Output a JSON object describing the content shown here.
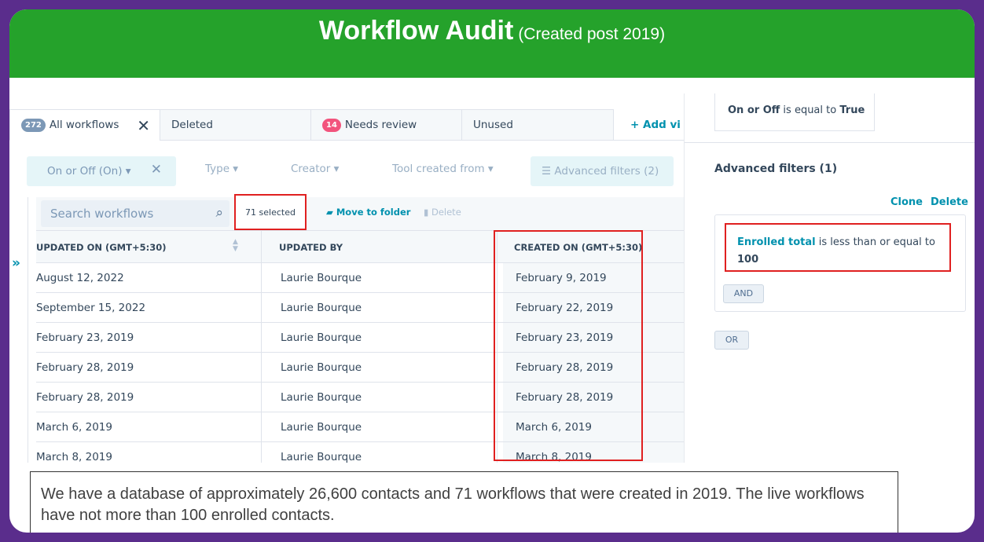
{
  "banner": {
    "title": "Workflow Audit",
    "subtitle": "(Created post 2019)"
  },
  "tabs": [
    {
      "badge": "272",
      "badge_color": "#7c98b6",
      "label": "All workflows"
    },
    {
      "label": "Deleted"
    },
    {
      "badge": "14",
      "badge_color": "#f2547d",
      "label": "Needs review"
    },
    {
      "label": "Unused"
    }
  ],
  "add_view_label": "+ Add vi",
  "filters": {
    "on_off": "On or Off (On) ▾",
    "type": "Type ▾",
    "creator": "Creator ▾",
    "tool_created_from": "Tool created from ▾",
    "advanced": "☰ Advanced filters (2)"
  },
  "search": {
    "placeholder": "Search workflows"
  },
  "bulk": {
    "selected": "71 selected",
    "move": "Move to folder",
    "delete": "Delete"
  },
  "table": {
    "headers": [
      "UPDATED ON (GMT+5:30)",
      "UPDATED BY",
      "CREATED ON (GMT+5:30)"
    ],
    "rows": [
      [
        "August 12, 2022",
        "Laurie Bourque",
        "February 9, 2019"
      ],
      [
        "September 15, 2022",
        "Laurie Bourque",
        "February 22, 2019"
      ],
      [
        "February 23, 2019",
        "Laurie Bourque",
        "February 23, 2019"
      ],
      [
        "February 28, 2019",
        "Laurie Bourque",
        "February 28, 2019"
      ],
      [
        "February 28, 2019",
        "Laurie Bourque",
        "February 28, 2019"
      ],
      [
        "March 6, 2019",
        "Laurie Bourque",
        "March 6, 2019"
      ],
      [
        "March 8, 2019",
        "Laurie Bourque",
        "March 8, 2019"
      ]
    ]
  },
  "panel": {
    "top_condition": {
      "prop": "On or Off",
      "op": " is equal to ",
      "value": "True"
    },
    "title": "Advanced filters (1)",
    "clone": "Clone",
    "delete": "Delete",
    "condition": {
      "prop": "Enrolled total",
      "op": " is less than or equal to",
      "value": "100"
    },
    "and": "AND",
    "or": "OR"
  },
  "caption": "We have a database of approximately 26,600 contacts and 71 workflows that were created in 2019. The live workflows have not more than 100 enrolled contacts."
}
